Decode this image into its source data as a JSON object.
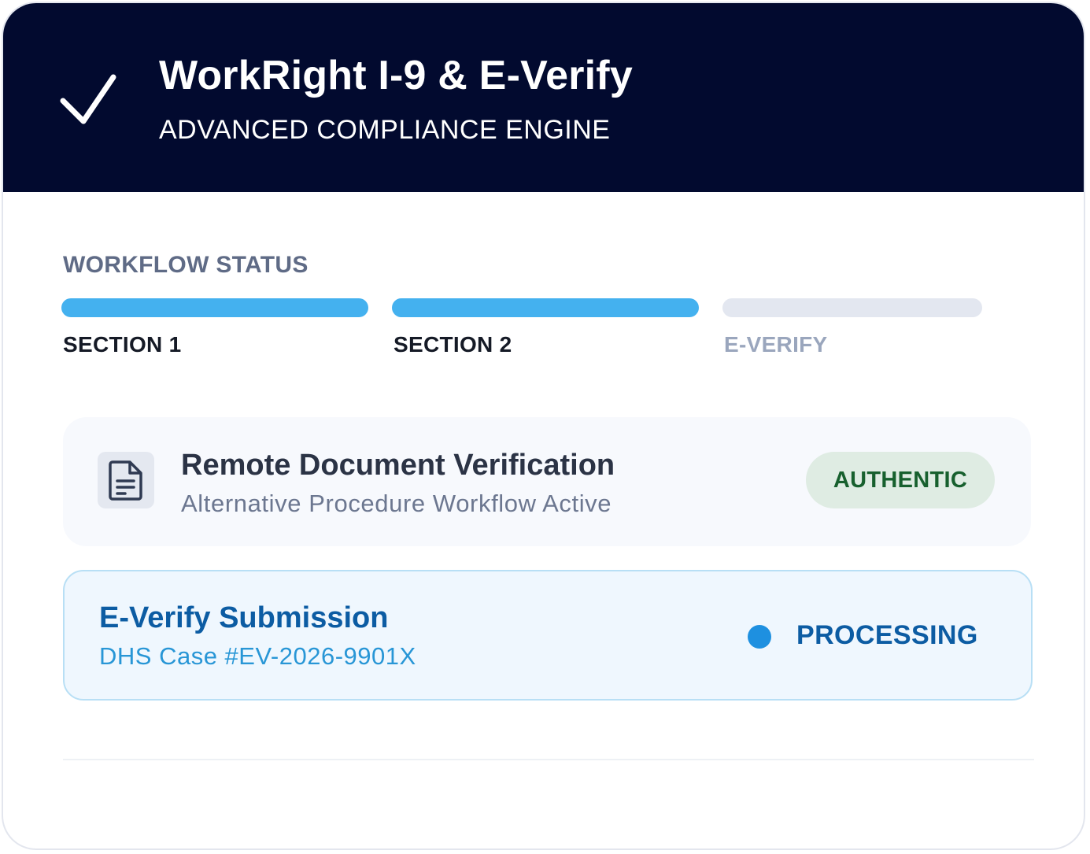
{
  "header": {
    "title": "WorkRight I-9 & E-Verify",
    "subtitle": "ADVANCED COMPLIANCE ENGINE",
    "icon": "checkmark-icon"
  },
  "workflow": {
    "heading": "WORKFLOW STATUS",
    "steps": [
      {
        "label": "SECTION 1",
        "state": "complete",
        "progress": 1.0
      },
      {
        "label": "SECTION 2",
        "state": "complete",
        "progress": 1.0
      },
      {
        "label": "E-VERIFY",
        "state": "pending",
        "progress": 0.0
      }
    ]
  },
  "document_verification": {
    "title": "Remote Document Verification",
    "subtitle": "Alternative Procedure Workflow Active",
    "badge": "AUTHENTIC",
    "icon": "document-icon"
  },
  "everify": {
    "title": "E-Verify Submission",
    "case": "DHS Case #EV-2026-9901X",
    "status": "PROCESSING"
  },
  "colors": {
    "header_bg": "#020a2f",
    "step_complete": "#44b1ef",
    "step_pending": "#e3e7f0",
    "authentic_bg": "#dfece3",
    "authentic_text": "#17602e",
    "processing_dot": "#1e90e0",
    "everify_text": "#0c5ca3"
  }
}
